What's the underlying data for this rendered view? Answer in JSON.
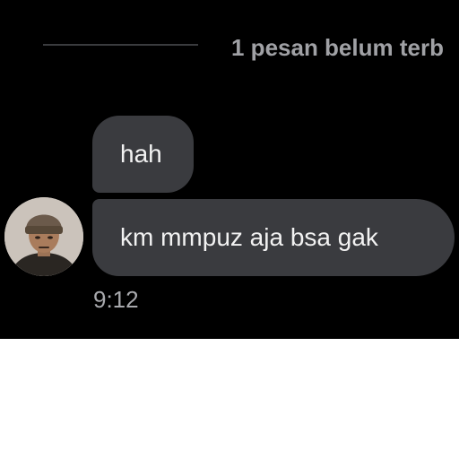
{
  "divider": {
    "unread_label": "1 pesan belum terb"
  },
  "messages": [
    {
      "text": "hah"
    },
    {
      "text": "km mmpuz aja bsa gak"
    }
  ],
  "timestamp": "9:12",
  "colors": {
    "background": "#000000",
    "bubble": "#3a3b3f",
    "bubble_text": "#f2f2f2",
    "meta_text": "#a0a1a5"
  },
  "icons": {
    "avatar": "user-avatar-photo"
  }
}
